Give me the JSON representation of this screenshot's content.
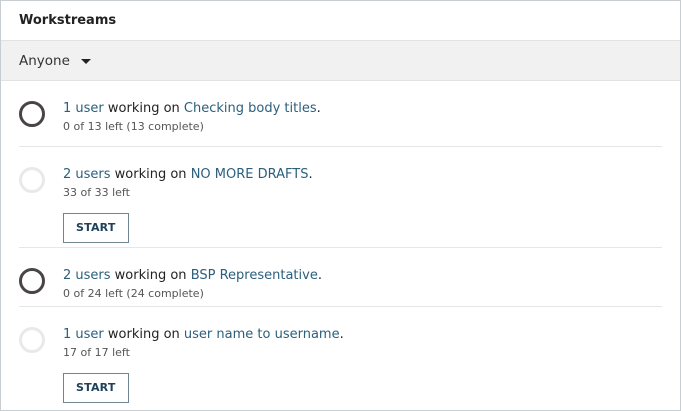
{
  "header": {
    "title": "Workstreams"
  },
  "filter": {
    "selected": "Anyone"
  },
  "items": [
    {
      "users": "1 user",
      "middle": " working on ",
      "task": "Checking body titles",
      "period": ".",
      "progress": "0 of 13 left (13 complete)",
      "has_start": false,
      "status": "complete"
    },
    {
      "users": "2 users",
      "middle": " working on ",
      "task": "NO MORE DRAFTS",
      "period": ".",
      "progress": "33 of 33 left",
      "has_start": true,
      "start_label": "START",
      "status": "not-started"
    },
    {
      "users": "2 users",
      "middle": " working on ",
      "task": "BSP Representative",
      "period": ".",
      "progress": "0 of 24 left (24 complete)",
      "has_start": false,
      "status": "complete"
    },
    {
      "users": "1 user",
      "middle": " working on ",
      "task": "user name to username",
      "period": ".",
      "progress": "17 of 17 left",
      "has_start": true,
      "start_label": "START",
      "status": "not-started"
    }
  ]
}
